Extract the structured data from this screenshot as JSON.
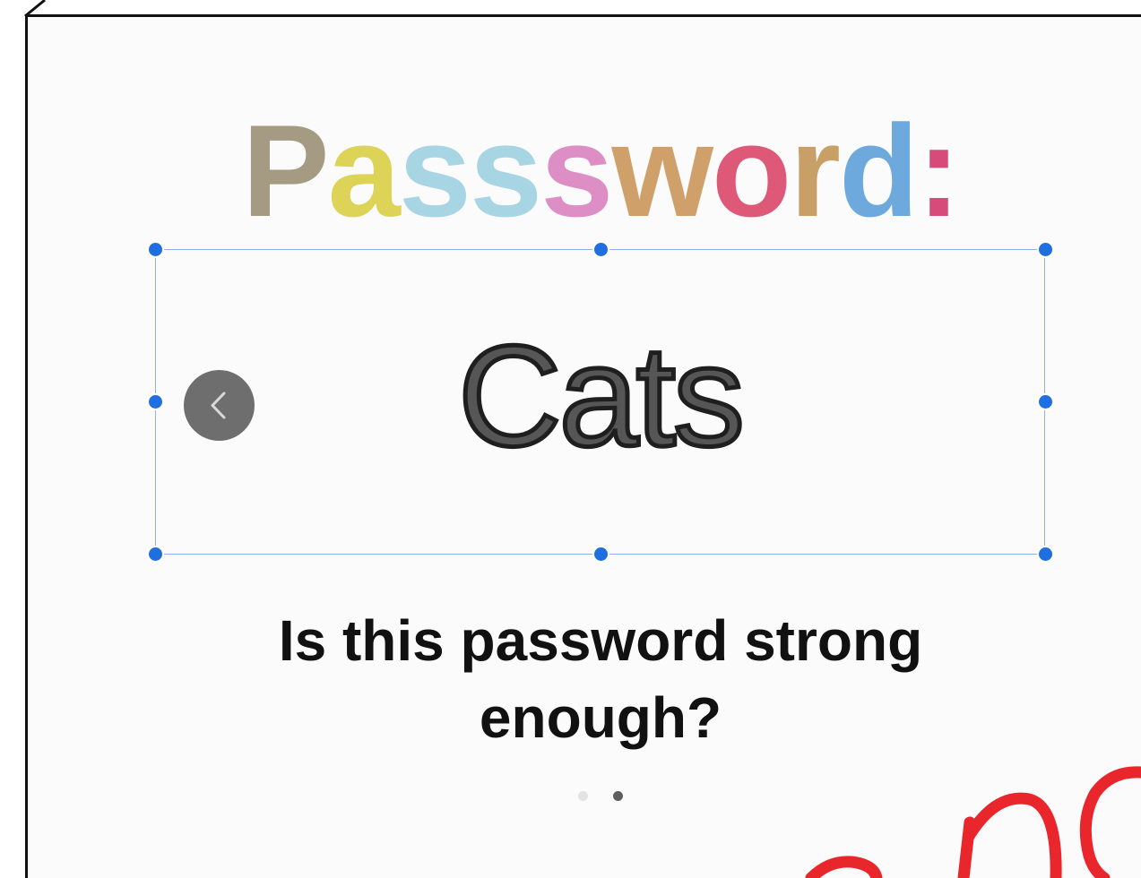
{
  "slide": {
    "title": {
      "letters": [
        {
          "char": "P",
          "color": "#a59a82"
        },
        {
          "char": "a",
          "color": "#dcd357"
        },
        {
          "char": "s",
          "color": "#a8d5e4"
        },
        {
          "char": "s",
          "color": "#a8d5e4"
        },
        {
          "char": "s",
          "color": "#dd8fc5"
        },
        {
          "char": "w",
          "color": "#cfa06a"
        },
        {
          "char": "o",
          "color": "#de5878"
        },
        {
          "char": "r",
          "color": "#c8a067"
        },
        {
          "char": "d",
          "color": "#6ea9dd"
        },
        {
          "char": ":",
          "color": "#d74b7a"
        }
      ]
    },
    "password_text": "Cats",
    "question": "Is this password strong enough?",
    "pagination": {
      "total": 2,
      "current": 2
    }
  },
  "icons": {
    "prev": "chevron-left-icon"
  },
  "colors": {
    "selection_border": "#8fb2ee",
    "handle": "#1f6fe0",
    "prev_button": "#6e6e6e",
    "annotation_red": "#e8262c"
  }
}
